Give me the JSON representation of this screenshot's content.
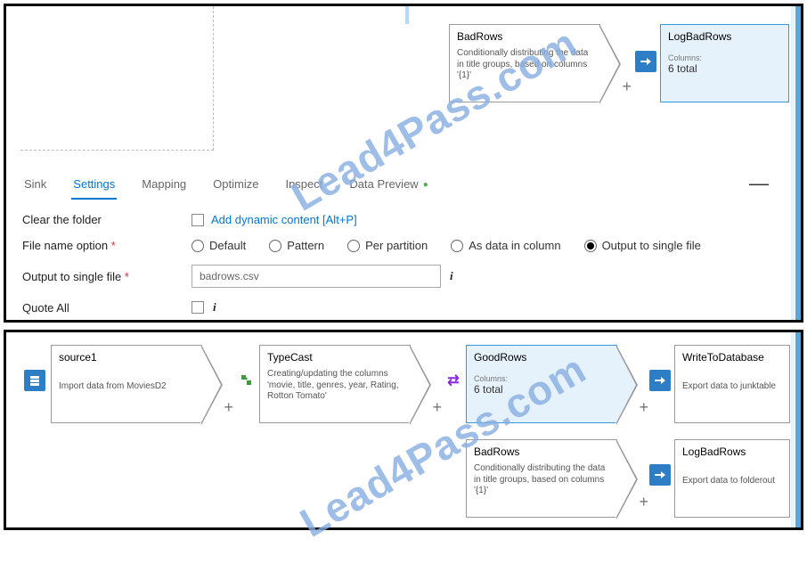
{
  "frame1": {
    "nodes": {
      "bad_rows": {
        "title": "BadRows",
        "desc": "Conditionally distributing the data in title groups, based on columns '{1}'"
      },
      "log_bad_rows": {
        "title": "LogBadRows",
        "columns_label": "Columns:",
        "columns_val": "6 total"
      }
    },
    "tabs": {
      "sink": "Sink",
      "settings": "Settings",
      "mapping": "Mapping",
      "optimize": "Optimize",
      "inspect": "Inspect",
      "data_preview": "Data Preview"
    },
    "settings": {
      "clear_folder_label": "Clear the folder",
      "add_dynamic": "Add dynamic content [Alt+P]",
      "file_name_option_label": "File name option",
      "radios": {
        "default": "Default",
        "pattern": "Pattern",
        "per_partition": "Per partition",
        "as_col": "As data in column",
        "output_single": "Output to single file"
      },
      "output_file_label": "Output to single file",
      "output_file_value": "badrows.csv",
      "quote_all_label": "Quote All"
    }
  },
  "frame2": {
    "nodes": {
      "source1": {
        "title": "source1",
        "desc": "Import data from MoviesD2"
      },
      "typecast": {
        "title": "TypeCast",
        "desc": "Creating/updating the columns 'movie, title, genres, year, Rating, Rotton Tomato'"
      },
      "good_rows": {
        "title": "GoodRows",
        "columns_label": "Columns:",
        "columns_val": "6 total"
      },
      "write_db": {
        "title": "WriteToDatabase",
        "desc": "Export data to junktable"
      },
      "bad_rows": {
        "title": "BadRows",
        "desc": "Conditionally distributing the data in title groups, based on columns '{1}'"
      },
      "log_bad_rows": {
        "title": "LogBadRows",
        "desc": "Export data to folderout"
      }
    }
  },
  "watermark": "Lead4Pass.com"
}
